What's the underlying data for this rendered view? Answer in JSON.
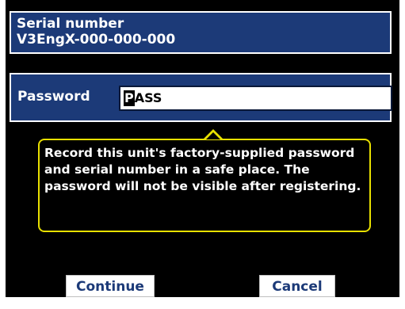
{
  "serial": {
    "label": "Serial number",
    "value": "V3EngX-000-000-000"
  },
  "password": {
    "label": "Password",
    "cursor_char": "P",
    "rest_value": "ASS"
  },
  "tooltip": {
    "text": "Record this unit's factory-supplied password and serial number in a safe place.  The password will not be visible after registering."
  },
  "buttons": {
    "continue_label": "Continue",
    "cancel_label": "Cancel"
  },
  "colors": {
    "panel_background": "#000000",
    "box_fill": "#1c3a78",
    "tooltip_border": "#e8e000",
    "button_text": "#1c3a78"
  }
}
